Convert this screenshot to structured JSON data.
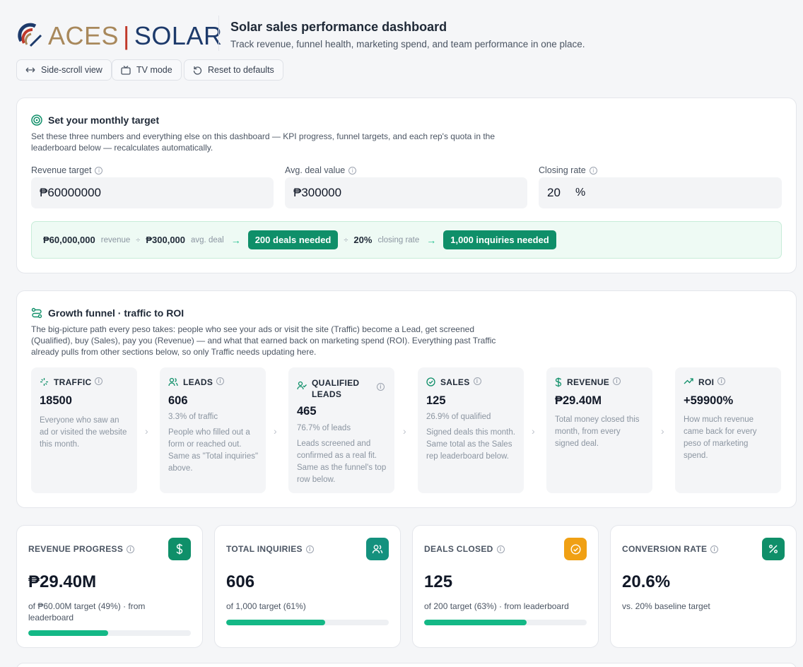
{
  "brand": {
    "part1": "ACES",
    "separator": "|",
    "part2": "SOLAR"
  },
  "header": {
    "title": "Solar sales performance dashboard",
    "subtitle": "Track revenue, funnel health, marketing spend, and team performance in one place."
  },
  "toolbar": {
    "side_scroll": {
      "label": "Side-scroll view",
      "icon": "arrows-horizontal-icon"
    },
    "tv_mode": {
      "label": "TV mode",
      "icon": "tv-icon"
    },
    "reset": {
      "label": "Reset to defaults",
      "icon": "reset-icon"
    }
  },
  "target": {
    "title": "Set your monthly target",
    "description": "Set these three numbers and everything else on this dashboard — KPI progress, funnel targets, and each rep's quota in the leaderboard below — recalculates automatically.",
    "revenue_label": "Revenue target",
    "revenue_value": "₱60000000",
    "deal_label": "Avg. deal value",
    "deal_value": "₱300000",
    "closing_label": "Closing rate",
    "closing_value": "20",
    "closing_unit": "%",
    "calc": {
      "revenue": "₱60,000,000",
      "revenue_label": "revenue",
      "divide1": "÷",
      "deal": "₱300,000",
      "deal_label": "avg. deal",
      "deals_needed": "200 deals needed",
      "divide2": "÷",
      "rate": "20%",
      "rate_label": "closing rate",
      "inquiries_needed": "1,000 inquiries needed"
    }
  },
  "funnel": {
    "title": "Growth funnel · traffic to ROI",
    "description": "The big-picture path every peso takes: people who see your ads or visit the site (Traffic) become a Lead, get screened (Qualified), buy (Sales), pay you (Revenue) — and what that earned back on marketing spend (ROI). Everything past Traffic already pulls from other sections below, so only Traffic needs updating here.",
    "stages": [
      {
        "name": "TRAFFIC",
        "value": "18500",
        "sub": "",
        "desc": "Everyone who saw an ad or visited the website this month.",
        "icon": "sparkle-icon"
      },
      {
        "name": "LEADS",
        "value": "606",
        "sub": "3.3% of traffic",
        "desc": "People who filled out a form or reached out. Same as \"Total inquiries\" above.",
        "icon": "users-icon"
      },
      {
        "name": "QUALIFIED LEADS",
        "value": "465",
        "sub": "76.7% of leads",
        "desc": "Leads screened and confirmed as a real fit. Same as the funnel's top row below.",
        "icon": "user-check-icon"
      },
      {
        "name": "SALES",
        "value": "125",
        "sub": "26.9% of qualified",
        "desc": "Signed deals this month. Same total as the Sales rep leaderboard below.",
        "icon": "check-circle-icon"
      },
      {
        "name": "REVENUE",
        "value": "₱29.40M",
        "sub": "",
        "desc": "Total money closed this month, from every signed deal.",
        "icon": "dollar-icon"
      },
      {
        "name": "ROI",
        "value": "+59900%",
        "sub": "",
        "desc": "How much revenue came back for every peso of marketing spend.",
        "icon": "trend-up-icon"
      }
    ]
  },
  "kpis": [
    {
      "label": "REVENUE PROGRESS",
      "value": "₱29.40M",
      "sub": "of ₱60.00M target (49%) · from leaderboard",
      "progress": 0.49,
      "icon": "dollar-icon",
      "color": "#0f8f69"
    },
    {
      "label": "TOTAL INQUIRIES",
      "value": "606",
      "sub": "of 1,000 target (61%)",
      "progress": 0.61,
      "icon": "users-icon",
      "color": "#14917e"
    },
    {
      "label": "DEALS CLOSED",
      "value": "125",
      "sub": "of 200 target (63%) · from leaderboard",
      "progress": 0.63,
      "icon": "check-circle-icon",
      "color": "#f0a014"
    },
    {
      "label": "CONVERSION RATE",
      "value": "20.6%",
      "sub": "vs. 20% baseline target",
      "icon": "percent-icon",
      "color": "#0f8f69"
    }
  ],
  "colors": {
    "accent": "#0f8f69",
    "progress": "#14b886",
    "calc_bg": "#eefaf4"
  }
}
